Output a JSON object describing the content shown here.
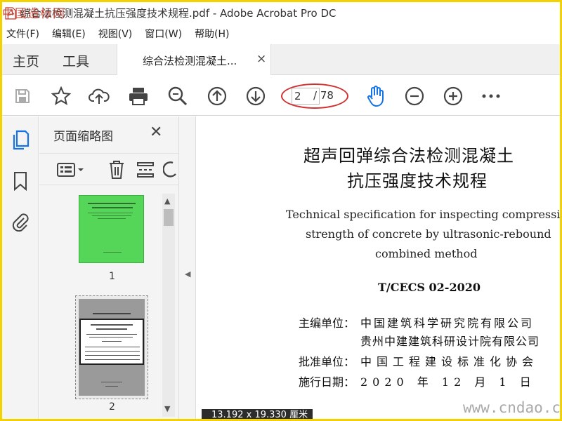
{
  "window": {
    "title": "综合法检测混凝土抗压强度技术规程.pdf - Adobe Acrobat Pro DC",
    "watermark_top": "中国造标网"
  },
  "menubar": [
    "文件(F)",
    "编辑(E)",
    "视图(V)",
    "窗口(W)",
    "帮助(H)"
  ],
  "tabs": {
    "home": "主页",
    "tools": "工具",
    "document": "综合法检测混凝土...",
    "close_symbol": "×"
  },
  "toolbar": {
    "page_current": "2",
    "page_total": "/ 78",
    "icons": [
      "save-icon",
      "bookmark-star-icon",
      "upload-cloud-icon",
      "print-icon",
      "zoom-search-icon",
      "page-up-icon",
      "page-down-icon",
      "hand-tool-icon",
      "zoom-out-icon",
      "zoom-in-icon",
      "more-icon"
    ]
  },
  "panel": {
    "title": "页面缩略图",
    "close_symbol": "✕",
    "thumbnails": [
      {
        "label": "1",
        "color": "#55d658"
      },
      {
        "label": "2",
        "color": "#9a9a9a"
      }
    ]
  },
  "document": {
    "title_zh_line1": "超声回弹综合法检测混凝土",
    "title_zh_line2": "抗压强度技术规程",
    "title_en_line1": "Technical specification for inspecting compressive",
    "title_en_line2": "strength of concrete by ultrasonic-rebound",
    "title_en_line3": "combined method",
    "code": "T/CECS 02-2020",
    "editor_label": "主编单位：",
    "editor_1": "中国建筑科学研究院有限公司",
    "editor_2": "贵州中建建筑科研设计院有限公司",
    "approver_label": "批准单位：",
    "approver": "中国工程建设标准化协会",
    "date_label": "施行日期：",
    "date": "2020 年 12 月 1 日"
  },
  "status": {
    "dimensions": "13.192 x 19.330 厘米"
  },
  "watermark_bottom": "www.cndao.com",
  "colors": {
    "accent_blue": "#1473e6",
    "highlight_red": "#d03030",
    "frame_yellow": "#f2d200"
  }
}
